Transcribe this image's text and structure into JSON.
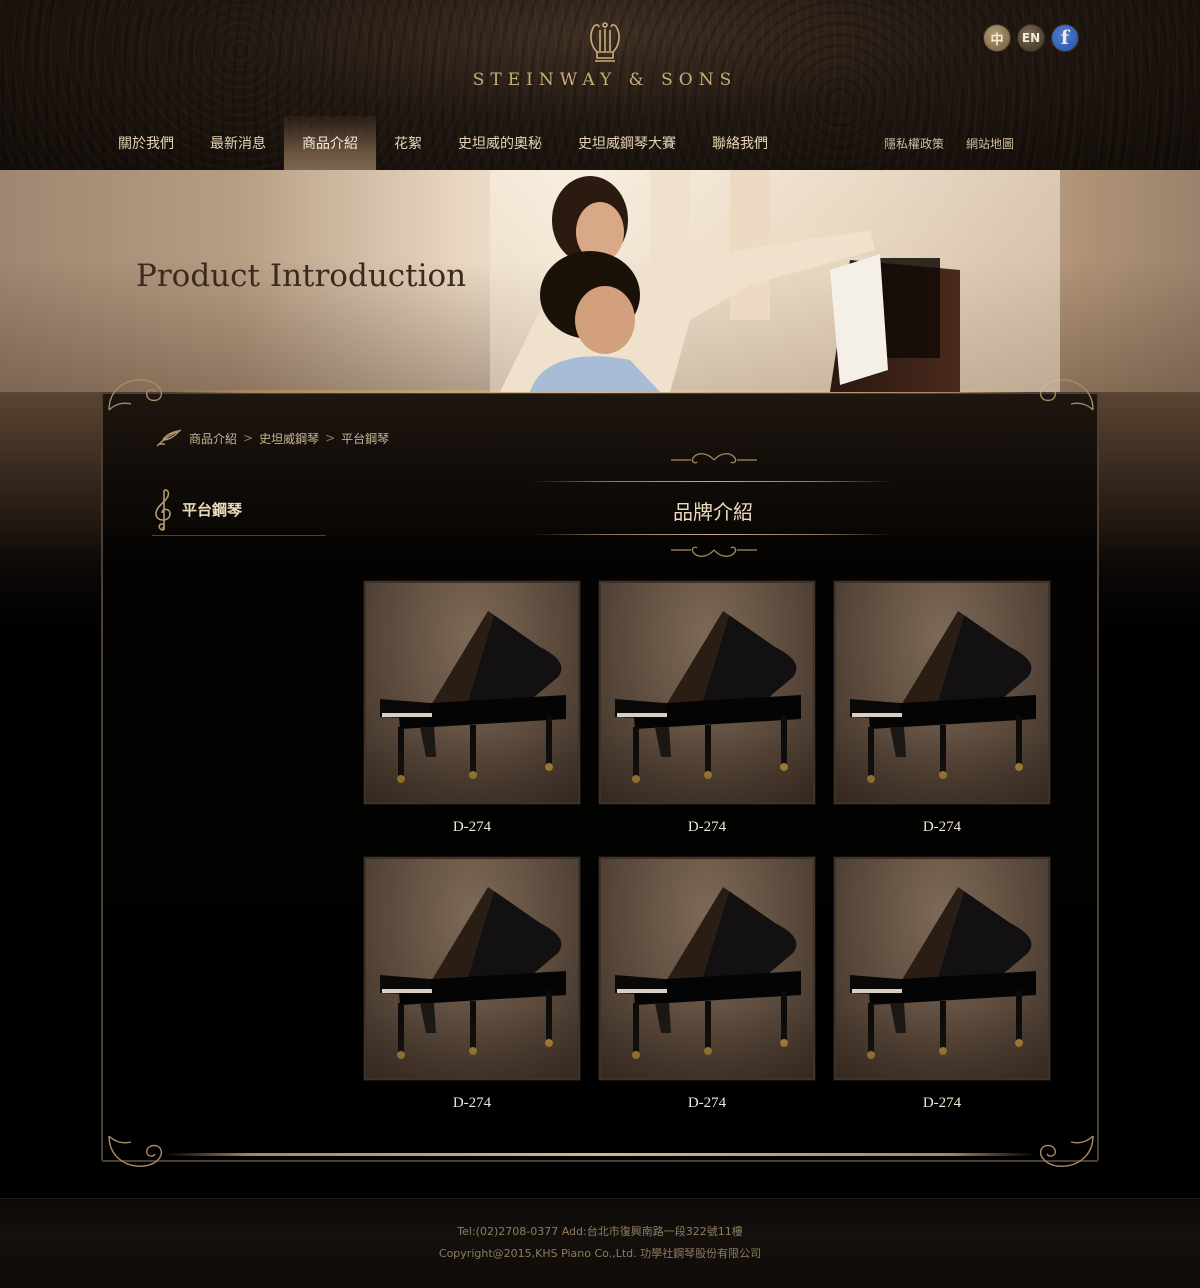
{
  "header": {
    "brand": "STEINWAY & SONS",
    "logo_icon": "lyre-icon",
    "lang": {
      "zh": "中",
      "en": "EN",
      "facebook": "f"
    }
  },
  "nav": {
    "items": [
      {
        "label": "關於我們"
      },
      {
        "label": "最新消息"
      },
      {
        "label": "商品介紹",
        "active": true
      },
      {
        "label": "花絮"
      },
      {
        "label": "史坦威的奧秘"
      },
      {
        "label": "史坦威鋼琴大賽"
      },
      {
        "label": "聯絡我們"
      }
    ],
    "right": [
      {
        "label": "隱私權政策"
      },
      {
        "label": "網站地圖"
      }
    ]
  },
  "banner": {
    "title": "Product Introduction"
  },
  "breadcrumb": {
    "icon": "quill-icon",
    "items": [
      "商品介紹",
      "史坦威鋼琴",
      "平台鋼琴"
    ],
    "separator": ">"
  },
  "sidebar": {
    "icon": "treble-clef-icon",
    "title": "平台鋼琴"
  },
  "section": {
    "title": "品牌介紹"
  },
  "products": [
    {
      "name": "D-274"
    },
    {
      "name": "D-274"
    },
    {
      "name": "D-274"
    },
    {
      "name": "D-274"
    },
    {
      "name": "D-274"
    },
    {
      "name": "D-274"
    }
  ],
  "footer": {
    "line1": "Tel:(02)2708-0377 Add:台北市復興南路一段322號11樓",
    "line2": "Copyright@2015,KHS Piano Co.,Ltd. 功學社鋼琴股份有限公司"
  },
  "colors": {
    "accent_gold": "#c9ad7c",
    "text_cream": "#eadbbd",
    "facebook_blue": "#3b5bb5"
  }
}
